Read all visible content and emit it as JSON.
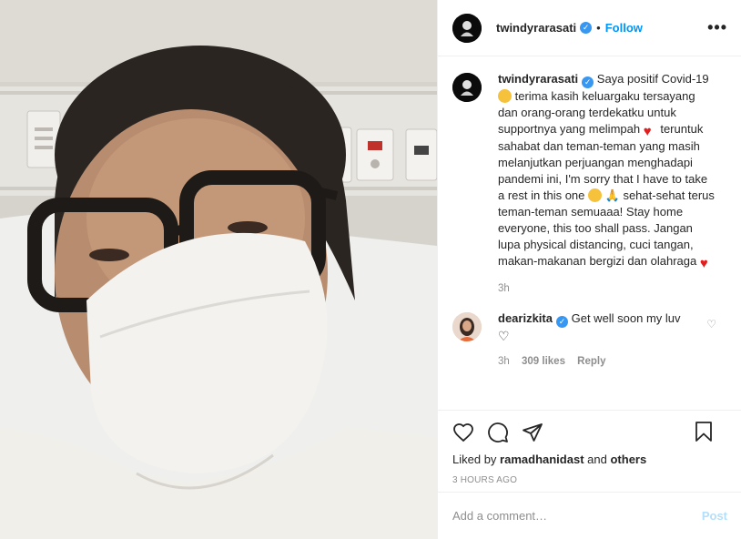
{
  "photo": {
    "alt_icon": "selfie-photo",
    "colors": {
      "wall": "#dcd9d3",
      "panel": "#e8e6e1",
      "skin": "#b58a6c",
      "hair": "#2b2522",
      "mask": "#f2f1ee",
      "glasses": "#1e1a17"
    }
  },
  "header": {
    "username": "twindyrarasati",
    "separator": "•",
    "follow_label": "Follow",
    "more_label": "•••"
  },
  "caption": {
    "username": "twindyrarasati",
    "part1": "Saya positif Covid-19",
    "part2": "terima kasih keluargaku tersayang dan orang-orang terdekatku untuk supportnya yang melimpah",
    "part3": "teruntuk sahabat dan teman-teman yang masih melanjutkan perjuangan menghadapi pandemi ini, I'm sorry that I have to take a rest in this one",
    "part4": "sehat-sehat terus teman-teman semuaaa! Stay home everyone, this too shall pass. Jangan lupa physical distancing, cuci tangan, makan-makanan bergizi dan olahraga",
    "time": "3h"
  },
  "comment": {
    "username": "dearizkita",
    "text": "Get well soon my luv",
    "heart": "♡",
    "time": "3h",
    "likes": "309 likes",
    "reply": "Reply"
  },
  "actions": {
    "liked_prefix": "Liked by",
    "liked_user": "ramadhanidast",
    "liked_and": "and",
    "liked_others": "others",
    "timestamp": "3 HOURS AGO"
  },
  "add_comment": {
    "placeholder": "Add a comment…",
    "post_label": "Post"
  },
  "colors": {
    "accent": "#0095f6",
    "verified": "#3897f0",
    "muted": "#8e8e8e",
    "post_disabled": "#b2dffc",
    "heart": "#e02020"
  }
}
